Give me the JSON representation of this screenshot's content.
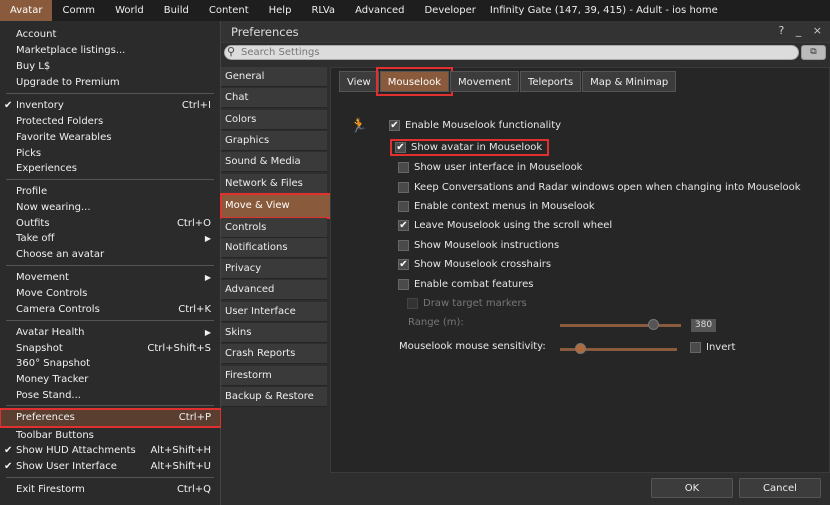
{
  "menubar": {
    "items": [
      {
        "label": "Avatar",
        "active": true
      },
      {
        "label": "Comm"
      },
      {
        "label": "World"
      },
      {
        "label": "Build"
      },
      {
        "label": "Content"
      },
      {
        "label": "Help"
      },
      {
        "label": "RLVa"
      },
      {
        "label": "Advanced"
      },
      {
        "label": "Developer"
      }
    ],
    "status": "Infinity Gate (147, 39, 415) - Adult - ios home"
  },
  "avatar_menu": {
    "items": [
      {
        "label": "Account",
        "shortcut": ""
      },
      {
        "label": "Marketplace listings...",
        "shortcut": ""
      },
      {
        "label": "Buy L$",
        "shortcut": ""
      },
      {
        "label": "Upgrade to Premium",
        "shortcut": ""
      },
      {
        "label": "Inventory",
        "shortcut": "Ctrl+I",
        "checked": true
      },
      {
        "label": "Protected Folders",
        "shortcut": ""
      },
      {
        "label": "Favorite Wearables",
        "shortcut": ""
      },
      {
        "label": "Picks",
        "shortcut": ""
      },
      {
        "label": "Experiences",
        "shortcut": ""
      },
      {
        "label": "Profile",
        "shortcut": ""
      },
      {
        "label": "Now wearing...",
        "shortcut": ""
      },
      {
        "label": "Outfits",
        "shortcut": "Ctrl+O"
      },
      {
        "label": "Take off",
        "shortcut": "",
        "submenu": true
      },
      {
        "label": "Choose an avatar",
        "shortcut": ""
      },
      {
        "label": "Movement",
        "shortcut": "",
        "submenu": true
      },
      {
        "label": "Move Controls",
        "shortcut": ""
      },
      {
        "label": "Camera Controls",
        "shortcut": "Ctrl+K"
      },
      {
        "label": "Avatar Health",
        "shortcut": "",
        "submenu": true
      },
      {
        "label": "Snapshot",
        "shortcut": "Ctrl+Shift+S"
      },
      {
        "label": "360° Snapshot",
        "shortcut": ""
      },
      {
        "label": "Money Tracker",
        "shortcut": ""
      },
      {
        "label": "Pose Stand...",
        "shortcut": ""
      },
      {
        "label": "Preferences",
        "shortcut": "Ctrl+P",
        "highlighted": true
      },
      {
        "label": "Toolbar Buttons",
        "shortcut": ""
      },
      {
        "label": "Show HUD Attachments",
        "shortcut": "Alt+Shift+H",
        "checked": true
      },
      {
        "label": "Show User Interface",
        "shortcut": "Alt+Shift+U",
        "checked": true
      },
      {
        "label": "Exit Firestorm",
        "shortcut": "Ctrl+Q"
      }
    ]
  },
  "prefs": {
    "title": "Preferences",
    "window_controls": "? _ ×",
    "search_placeholder": "Search Settings",
    "categories": [
      {
        "label": "General"
      },
      {
        "label": "Chat"
      },
      {
        "label": "Colors"
      },
      {
        "label": "Graphics"
      },
      {
        "label": "Sound & Media"
      },
      {
        "label": "Network & Files"
      },
      {
        "label": "Move & View",
        "selected": true
      },
      {
        "label": "Controls"
      },
      {
        "label": "Notifications"
      },
      {
        "label": "Privacy"
      },
      {
        "label": "Advanced"
      },
      {
        "label": "User Interface"
      },
      {
        "label": "Skins"
      },
      {
        "label": "Crash Reports"
      },
      {
        "label": "Firestorm"
      },
      {
        "label": "Backup & Restore"
      }
    ],
    "tabs": [
      {
        "label": "View"
      },
      {
        "label": "Mouselook",
        "selected": true
      },
      {
        "label": "Movement"
      },
      {
        "label": "Teleports"
      },
      {
        "label": "Map & Minimap"
      }
    ],
    "mouselook": {
      "options": [
        {
          "label": "Enable Mouselook functionality",
          "checked": true
        },
        {
          "label": "Show avatar in Mouselook",
          "checked": true,
          "highlighted": true
        },
        {
          "label": "Show user interface in Mouselook",
          "checked": false
        },
        {
          "label": "Keep Conversations and Radar windows open when changing into Mouselook",
          "checked": false
        },
        {
          "label": "Enable context menus in Mouselook",
          "checked": false
        },
        {
          "label": "Leave Mouselook using the scroll wheel",
          "checked": true
        },
        {
          "label": "Show Mouselook instructions",
          "checked": false
        },
        {
          "label": "Show Mouselook crosshairs",
          "checked": true
        },
        {
          "label": "Enable combat features",
          "checked": false
        },
        {
          "label": "Draw target markers",
          "checked": false,
          "disabled": true
        }
      ],
      "range_label": "Range (m):",
      "range_value": "380",
      "range_fraction": 0.78,
      "sensitivity_label": "Mouselook mouse sensitivity:",
      "sensitivity_fraction": 0.18,
      "invert_label": "Invert",
      "invert_checked": false
    },
    "ok_label": "OK",
    "cancel_label": "Cancel"
  }
}
